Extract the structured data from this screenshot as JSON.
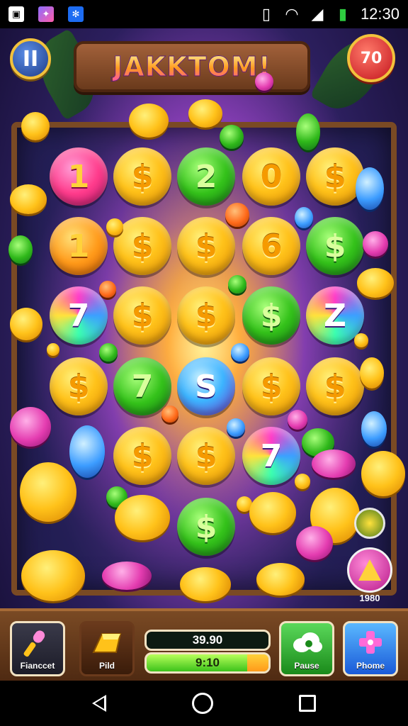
{
  "status_bar": {
    "time": "12:30",
    "icons": [
      "notification-a-icon",
      "gallery-icon",
      "pinwheel-icon",
      "vibrate-icon",
      "wifi-icon",
      "signal-icon",
      "battery-icon"
    ]
  },
  "header": {
    "pause_label": "II",
    "title": "JAKKTOM!",
    "counter_badge": "70"
  },
  "board": {
    "rows": [
      [
        {
          "symbol": "1",
          "style": "pink"
        },
        {
          "symbol": "$",
          "style": "gold"
        },
        {
          "symbol": "2",
          "style": "green"
        },
        {
          "symbol": "0",
          "style": "gold"
        },
        {
          "symbol": "$",
          "style": "gold"
        }
      ],
      [
        {
          "symbol": "1",
          "style": "orange"
        },
        {
          "symbol": "$",
          "style": "gold"
        },
        {
          "symbol": "$",
          "style": "gold"
        },
        {
          "symbol": "6",
          "style": "gold"
        },
        {
          "symbol": "$",
          "style": "green"
        }
      ],
      [
        {
          "symbol": "7",
          "style": "rainbow"
        },
        {
          "symbol": "$",
          "style": "gold"
        },
        {
          "symbol": "$",
          "style": "gold"
        },
        {
          "symbol": "$",
          "style": "green"
        },
        {
          "symbol": "Z",
          "style": "rainbow"
        }
      ],
      [
        {
          "symbol": "$",
          "style": "gold"
        },
        {
          "symbol": "7",
          "style": "green"
        },
        {
          "symbol": "S",
          "style": "purpleblue"
        },
        {
          "symbol": "$",
          "style": "gold"
        },
        {
          "symbol": "$",
          "style": "gold"
        }
      ],
      [
        {
          "symbol": "",
          "style": "none"
        },
        {
          "symbol": "$",
          "style": "gold"
        },
        {
          "symbol": "$",
          "style": "gold"
        },
        {
          "symbol": "7",
          "style": "rainbow"
        },
        {
          "symbol": "",
          "style": "none"
        }
      ],
      [
        {
          "symbol": "",
          "style": "none"
        },
        {
          "symbol": "",
          "style": "none"
        },
        {
          "symbol": "$",
          "style": "green"
        },
        {
          "symbol": "",
          "style": "none"
        },
        {
          "symbol": "",
          "style": "none"
        }
      ]
    ]
  },
  "side_widget": {
    "label": "1980",
    "icon": "gem-triangle-icon"
  },
  "bottom_panel": {
    "button_left_1": {
      "label": "Fianccet",
      "icon": "microphone-icon"
    },
    "button_left_2": {
      "label": "Pild",
      "icon": "gold-bar-icon"
    },
    "meter_top": "39.90",
    "meter_bottom": "9:10",
    "button_right_1": {
      "label": "Pause",
      "icon": "cloud-icon"
    },
    "button_right_2": {
      "label": "Phome",
      "icon": "dpad-icon"
    }
  },
  "colors": {
    "wood": "#7a4a24",
    "gold": "#ffc21a",
    "green": "#34c21a",
    "pink": "#ff3c8c",
    "frame_accent": "#f2c23c"
  }
}
